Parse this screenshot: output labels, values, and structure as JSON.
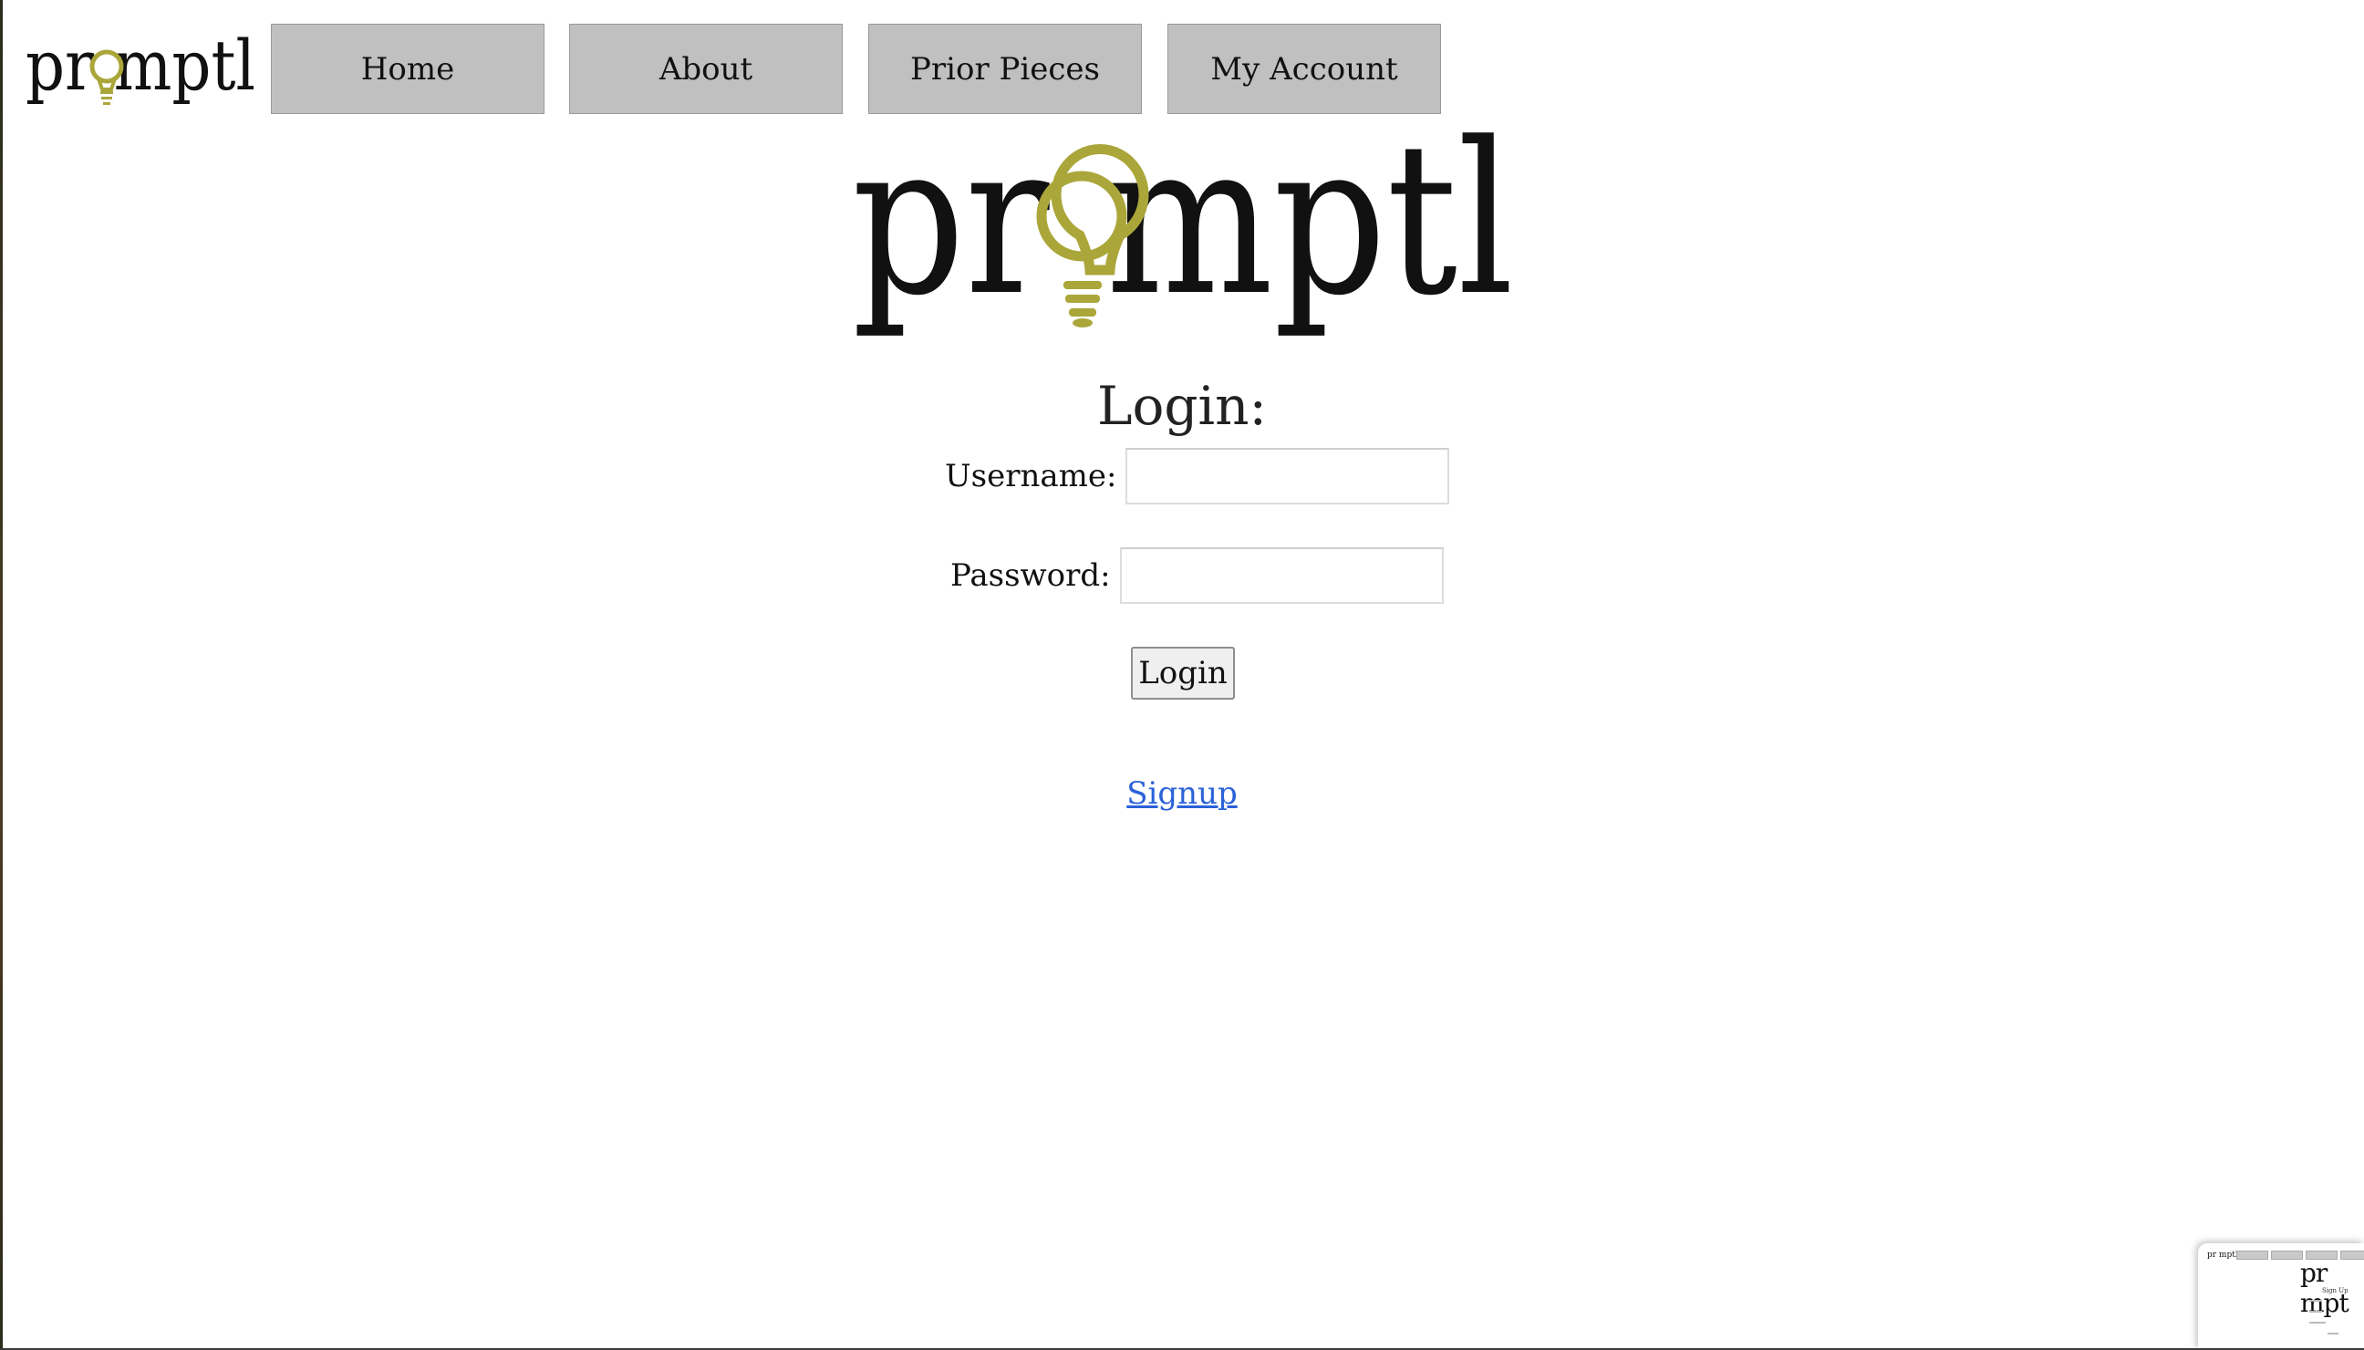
{
  "brand": {
    "name": "promptl",
    "bulb_color": "#aaa63a"
  },
  "nav": {
    "home": "Home",
    "about": "About",
    "prior_pieces": "Prior Pieces",
    "my_account": "My Account"
  },
  "login": {
    "title": "Login:",
    "username_label": "Username:",
    "username_value": "",
    "password_label": "Password:",
    "password_value": "",
    "submit_label": "Login",
    "signup_link": "Signup"
  },
  "thumbnail": {
    "title": "Sign Up"
  },
  "colors": {
    "nav_button_bg": "#c0c0c0",
    "link": "#2a62d8",
    "background": "#ffffff"
  }
}
